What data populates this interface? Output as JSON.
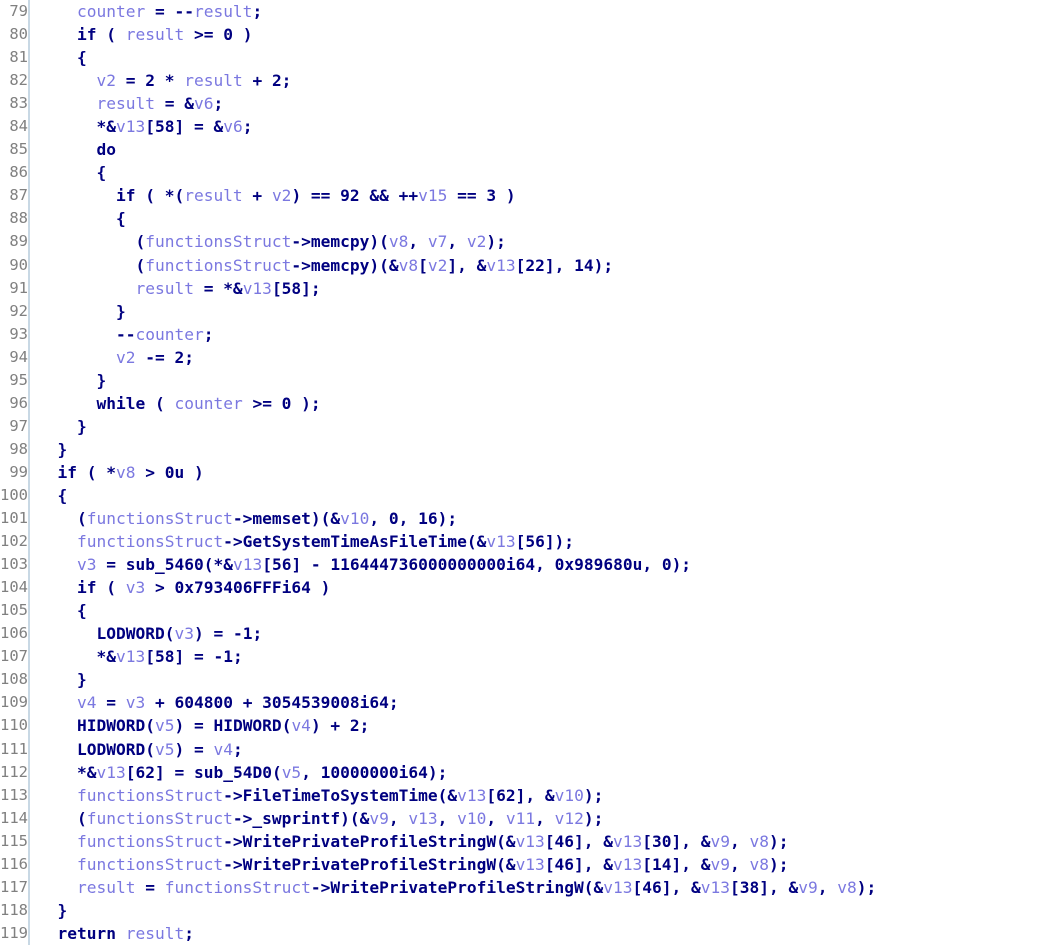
{
  "view": {
    "name": "hex-rays-pseudocode-view",
    "background_color": "#ffffff",
    "gutter_color": "#808080",
    "gutter_rule_color": "#c8d8e4",
    "keyword_color": "#000080",
    "variable_color": "#7b78e0"
  },
  "lines": [
    {
      "num": "79",
      "indent": 4,
      "text": "counter = --result;"
    },
    {
      "num": "80",
      "indent": 4,
      "text": "if ( result >= 0 )"
    },
    {
      "num": "81",
      "indent": 4,
      "text": "{"
    },
    {
      "num": "82",
      "indent": 6,
      "text": "v2 = 2 * result + 2;"
    },
    {
      "num": "83",
      "indent": 6,
      "text": "result = &v6;"
    },
    {
      "num": "84",
      "indent": 6,
      "text": "*&v13[58] = &v6;"
    },
    {
      "num": "85",
      "indent": 6,
      "text": "do"
    },
    {
      "num": "86",
      "indent": 6,
      "text": "{"
    },
    {
      "num": "87",
      "indent": 8,
      "text": "if ( *(result + v2) == 92 && ++v15 == 3 )"
    },
    {
      "num": "88",
      "indent": 8,
      "text": "{"
    },
    {
      "num": "89",
      "indent": 10,
      "text": "(functionsStruct->memcpy)(v8, v7, v2);"
    },
    {
      "num": "90",
      "indent": 10,
      "text": "(functionsStruct->memcpy)(&v8[v2], &v13[22], 14);"
    },
    {
      "num": "91",
      "indent": 10,
      "text": "result = *&v13[58];"
    },
    {
      "num": "92",
      "indent": 8,
      "text": "}"
    },
    {
      "num": "93",
      "indent": 8,
      "text": "--counter;"
    },
    {
      "num": "94",
      "indent": 8,
      "text": "v2 -= 2;"
    },
    {
      "num": "95",
      "indent": 6,
      "text": "}"
    },
    {
      "num": "96",
      "indent": 6,
      "text": "while ( counter >= 0 );"
    },
    {
      "num": "97",
      "indent": 4,
      "text": "}"
    },
    {
      "num": "98",
      "indent": 2,
      "text": "}"
    },
    {
      "num": "99",
      "indent": 2,
      "text": "if ( *v8 > 0u )"
    },
    {
      "num": "100",
      "indent": 2,
      "text": "{"
    },
    {
      "num": "101",
      "indent": 4,
      "text": "(functionsStruct->memset)(&v10, 0, 16);"
    },
    {
      "num": "102",
      "indent": 4,
      "text": "functionsStruct->GetSystemTimeAsFileTime(&v13[56]);"
    },
    {
      "num": "103",
      "indent": 4,
      "text": "v3 = sub_5460(*&v13[56] - 116444736000000000i64, 0x989680u, 0);"
    },
    {
      "num": "104",
      "indent": 4,
      "text": "if ( v3 > 0x793406FFFi64 )"
    },
    {
      "num": "105",
      "indent": 4,
      "text": "{"
    },
    {
      "num": "106",
      "indent": 6,
      "text": "LODWORD(v3) = -1;"
    },
    {
      "num": "107",
      "indent": 6,
      "text": "*&v13[58] = -1;"
    },
    {
      "num": "108",
      "indent": 4,
      "text": "}"
    },
    {
      "num": "109",
      "indent": 4,
      "text": "v4 = v3 + 604800 + 3054539008i64;"
    },
    {
      "num": "110",
      "indent": 4,
      "text": "HIDWORD(v5) = HIDWORD(v4) + 2;"
    },
    {
      "num": "111",
      "indent": 4,
      "text": "LODWORD(v5) = v4;"
    },
    {
      "num": "112",
      "indent": 4,
      "text": "*&v13[62] = sub_54D0(v5, 10000000i64);"
    },
    {
      "num": "113",
      "indent": 4,
      "text": "functionsStruct->FileTimeToSystemTime(&v13[62], &v10);"
    },
    {
      "num": "114",
      "indent": 4,
      "text": "(functionsStruct->_swprintf)(&v9, v13, v10, v11, v12);"
    },
    {
      "num": "115",
      "indent": 4,
      "text": "functionsStruct->WritePrivateProfileStringW(&v13[46], &v13[30], &v9, v8);"
    },
    {
      "num": "116",
      "indent": 4,
      "text": "functionsStruct->WritePrivateProfileStringW(&v13[46], &v13[14], &v9, v8);"
    },
    {
      "num": "117",
      "indent": 4,
      "text": "result = functionsStruct->WritePrivateProfileStringW(&v13[46], &v13[38], &v9, v8);"
    },
    {
      "num": "118",
      "indent": 2,
      "text": "}"
    },
    {
      "num": "119",
      "indent": 2,
      "text": "return result;"
    }
  ]
}
